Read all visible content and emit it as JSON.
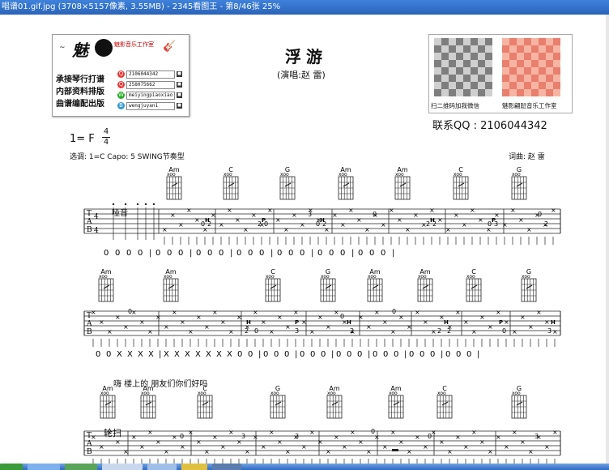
{
  "window": {
    "title": "唱谱01.gif.jpg (3708×5157像素, 3.55MB) - 2345看图王 - 第8/46张 25%"
  },
  "header": {
    "logo_char": "魅",
    "logo_text": "魅影音乐工作室",
    "logo_tilde": "~",
    "service_lines": [
      "承接琴行打谱",
      "内部资料排版",
      "曲谱编配出版"
    ],
    "contacts": [
      "2106044342",
      "258075662",
      "meiyingpiaoxiao",
      "wengjuyan1"
    ]
  },
  "song": {
    "title": "浮游",
    "singer": "(演唱:赵  雷)",
    "key": "1= F",
    "time_top": "4",
    "time_bottom": "4",
    "tuning": "选调: 1=C  Capo: 5 SWING节奏型",
    "credits": "词曲: 赵  雷"
  },
  "qr": {
    "left_caption": "扫二维码加我微信",
    "right_caption": "魅影翩跹音乐工作室",
    "qq": "联系QQ : 2106044342"
  },
  "tab_letters": [
    "T",
    "A",
    "B"
  ],
  "time_sig_digits": [
    "4",
    "4"
  ],
  "articulation": "哑音",
  "rows": [
    {
      "chords": [
        "Am",
        "C",
        "G",
        "Am",
        "Am",
        "C",
        "G"
      ],
      "rhythm": [
        "0",
        "0",
        "0",
        "0",
        "|",
        "0",
        "0",
        "0",
        "|",
        "0",
        "0",
        "0",
        "|",
        "0",
        "0",
        "0",
        "|",
        "0",
        "0",
        "0",
        "|",
        "0",
        "0",
        "0",
        "|",
        "0",
        "0",
        "0",
        "|"
      ],
      "fret_numbers": [
        "0",
        "2",
        "2",
        "0",
        "3",
        "0",
        "2",
        "0",
        "2",
        "2",
        "0",
        "3",
        "0",
        "2"
      ],
      "techniques": [
        "H",
        "P",
        "H",
        "H",
        "P"
      ]
    },
    {
      "chords": [
        "Am",
        "Am",
        "C",
        "G",
        "Am",
        "Am",
        "C",
        "G"
      ],
      "rhythm": [
        "0",
        "0",
        "X",
        "X",
        "X",
        "X",
        "|",
        "X",
        "X",
        "X",
        "X",
        "X",
        "X",
        "X",
        "0",
        "0",
        "|",
        "0",
        "0",
        "0",
        "|",
        "0",
        "0",
        "0",
        "|",
        "0",
        "0",
        "0",
        "|",
        "0",
        "0",
        "0",
        "|",
        "0",
        "0",
        "0",
        "|",
        "0",
        "0",
        "0",
        "|"
      ],
      "fret_numbers": [
        "0",
        "0",
        "2",
        "2",
        "0",
        "3",
        "0",
        "2",
        "0",
        "0",
        "2",
        "2",
        "0",
        "3",
        "0",
        "2"
      ],
      "techniques": [
        "H",
        "P",
        "H",
        "H",
        "P",
        "H"
      ],
      "lyrics": "嗨 楼上的 朋友们你们好吗"
    },
    {
      "chords": [
        "Am",
        "Am",
        "C",
        "G",
        "Am",
        "Am",
        "C",
        "G"
      ],
      "fret_numbers": [
        "0",
        "3",
        "3",
        "0",
        "0",
        "3"
      ],
      "annotation": "轮扫"
    }
  ],
  "colors": {
    "titlebar": "#2a63b8",
    "logo_red": "#cc0000",
    "qr_gray": "#7e7e7e",
    "qr_pink": "#e97f6e"
  }
}
